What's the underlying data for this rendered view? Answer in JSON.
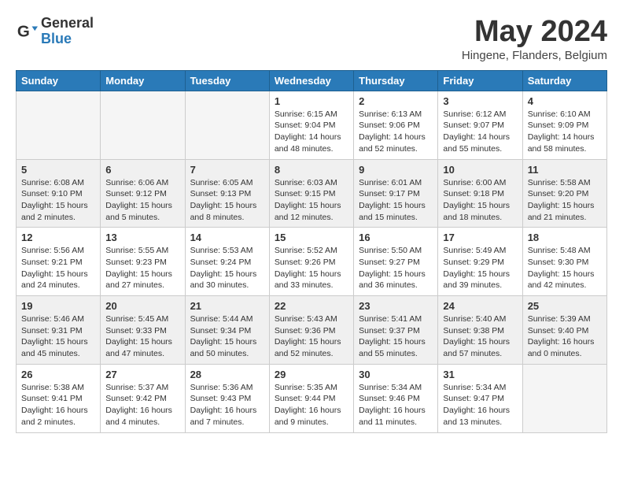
{
  "logo": {
    "general": "General",
    "blue": "Blue"
  },
  "title": {
    "month_year": "May 2024",
    "location": "Hingene, Flanders, Belgium"
  },
  "weekdays": [
    "Sunday",
    "Monday",
    "Tuesday",
    "Wednesday",
    "Thursday",
    "Friday",
    "Saturday"
  ],
  "weeks": [
    {
      "shaded": false,
      "days": [
        {
          "num": "",
          "info": ""
        },
        {
          "num": "",
          "info": ""
        },
        {
          "num": "",
          "info": ""
        },
        {
          "num": "1",
          "info": "Sunrise: 6:15 AM\nSunset: 9:04 PM\nDaylight: 14 hours\nand 48 minutes."
        },
        {
          "num": "2",
          "info": "Sunrise: 6:13 AM\nSunset: 9:06 PM\nDaylight: 14 hours\nand 52 minutes."
        },
        {
          "num": "3",
          "info": "Sunrise: 6:12 AM\nSunset: 9:07 PM\nDaylight: 14 hours\nand 55 minutes."
        },
        {
          "num": "4",
          "info": "Sunrise: 6:10 AM\nSunset: 9:09 PM\nDaylight: 14 hours\nand 58 minutes."
        }
      ]
    },
    {
      "shaded": true,
      "days": [
        {
          "num": "5",
          "info": "Sunrise: 6:08 AM\nSunset: 9:10 PM\nDaylight: 15 hours\nand 2 minutes."
        },
        {
          "num": "6",
          "info": "Sunrise: 6:06 AM\nSunset: 9:12 PM\nDaylight: 15 hours\nand 5 minutes."
        },
        {
          "num": "7",
          "info": "Sunrise: 6:05 AM\nSunset: 9:13 PM\nDaylight: 15 hours\nand 8 minutes."
        },
        {
          "num": "8",
          "info": "Sunrise: 6:03 AM\nSunset: 9:15 PM\nDaylight: 15 hours\nand 12 minutes."
        },
        {
          "num": "9",
          "info": "Sunrise: 6:01 AM\nSunset: 9:17 PM\nDaylight: 15 hours\nand 15 minutes."
        },
        {
          "num": "10",
          "info": "Sunrise: 6:00 AM\nSunset: 9:18 PM\nDaylight: 15 hours\nand 18 minutes."
        },
        {
          "num": "11",
          "info": "Sunrise: 5:58 AM\nSunset: 9:20 PM\nDaylight: 15 hours\nand 21 minutes."
        }
      ]
    },
    {
      "shaded": false,
      "days": [
        {
          "num": "12",
          "info": "Sunrise: 5:56 AM\nSunset: 9:21 PM\nDaylight: 15 hours\nand 24 minutes."
        },
        {
          "num": "13",
          "info": "Sunrise: 5:55 AM\nSunset: 9:23 PM\nDaylight: 15 hours\nand 27 minutes."
        },
        {
          "num": "14",
          "info": "Sunrise: 5:53 AM\nSunset: 9:24 PM\nDaylight: 15 hours\nand 30 minutes."
        },
        {
          "num": "15",
          "info": "Sunrise: 5:52 AM\nSunset: 9:26 PM\nDaylight: 15 hours\nand 33 minutes."
        },
        {
          "num": "16",
          "info": "Sunrise: 5:50 AM\nSunset: 9:27 PM\nDaylight: 15 hours\nand 36 minutes."
        },
        {
          "num": "17",
          "info": "Sunrise: 5:49 AM\nSunset: 9:29 PM\nDaylight: 15 hours\nand 39 minutes."
        },
        {
          "num": "18",
          "info": "Sunrise: 5:48 AM\nSunset: 9:30 PM\nDaylight: 15 hours\nand 42 minutes."
        }
      ]
    },
    {
      "shaded": true,
      "days": [
        {
          "num": "19",
          "info": "Sunrise: 5:46 AM\nSunset: 9:31 PM\nDaylight: 15 hours\nand 45 minutes."
        },
        {
          "num": "20",
          "info": "Sunrise: 5:45 AM\nSunset: 9:33 PM\nDaylight: 15 hours\nand 47 minutes."
        },
        {
          "num": "21",
          "info": "Sunrise: 5:44 AM\nSunset: 9:34 PM\nDaylight: 15 hours\nand 50 minutes."
        },
        {
          "num": "22",
          "info": "Sunrise: 5:43 AM\nSunset: 9:36 PM\nDaylight: 15 hours\nand 52 minutes."
        },
        {
          "num": "23",
          "info": "Sunrise: 5:41 AM\nSunset: 9:37 PM\nDaylight: 15 hours\nand 55 minutes."
        },
        {
          "num": "24",
          "info": "Sunrise: 5:40 AM\nSunset: 9:38 PM\nDaylight: 15 hours\nand 57 minutes."
        },
        {
          "num": "25",
          "info": "Sunrise: 5:39 AM\nSunset: 9:40 PM\nDaylight: 16 hours\nand 0 minutes."
        }
      ]
    },
    {
      "shaded": false,
      "days": [
        {
          "num": "26",
          "info": "Sunrise: 5:38 AM\nSunset: 9:41 PM\nDaylight: 16 hours\nand 2 minutes."
        },
        {
          "num": "27",
          "info": "Sunrise: 5:37 AM\nSunset: 9:42 PM\nDaylight: 16 hours\nand 4 minutes."
        },
        {
          "num": "28",
          "info": "Sunrise: 5:36 AM\nSunset: 9:43 PM\nDaylight: 16 hours\nand 7 minutes."
        },
        {
          "num": "29",
          "info": "Sunrise: 5:35 AM\nSunset: 9:44 PM\nDaylight: 16 hours\nand 9 minutes."
        },
        {
          "num": "30",
          "info": "Sunrise: 5:34 AM\nSunset: 9:46 PM\nDaylight: 16 hours\nand 11 minutes."
        },
        {
          "num": "31",
          "info": "Sunrise: 5:34 AM\nSunset: 9:47 PM\nDaylight: 16 hours\nand 13 minutes."
        },
        {
          "num": "",
          "info": ""
        }
      ]
    }
  ]
}
